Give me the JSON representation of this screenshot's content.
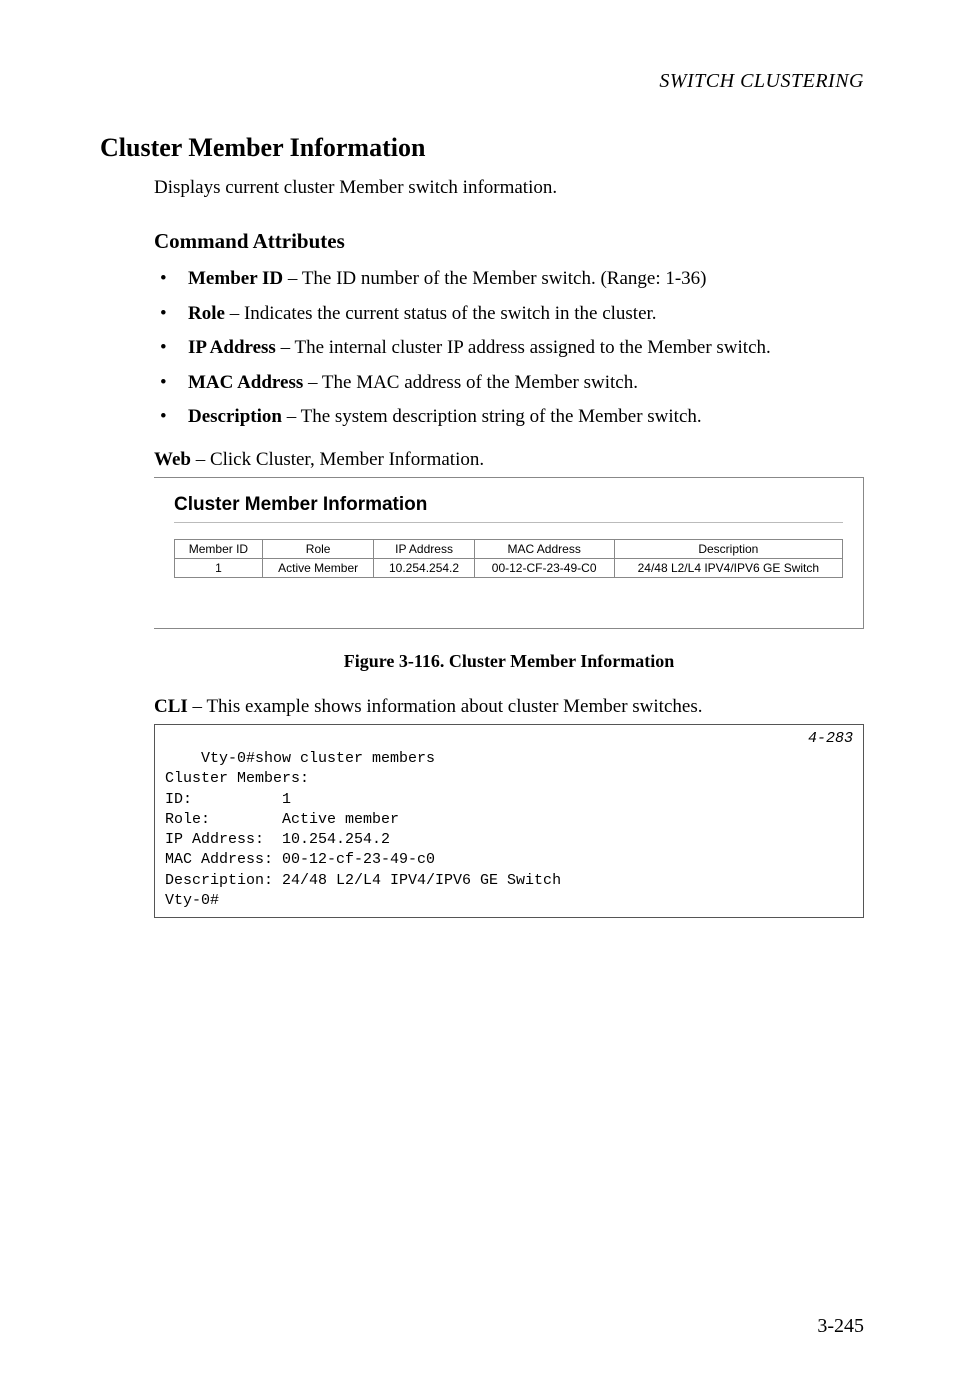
{
  "header": {
    "section": "SWITCH CLUSTERING"
  },
  "h2": "Cluster Member Information",
  "intro": "Displays current cluster Member switch information.",
  "h3": "Command Attributes",
  "bullets": [
    {
      "term": "Member ID",
      "desc": " – The ID number of the Member switch. (Range: 1-36)"
    },
    {
      "term": "Role",
      "desc": " – Indicates the current status of the switch in the cluster."
    },
    {
      "term": "IP Address",
      "desc": " – The internal cluster IP address assigned to the Member switch."
    },
    {
      "term": "MAC Address",
      "desc": " – The MAC address of the Member switch."
    },
    {
      "term": "Description",
      "desc": " – The system description string of the Member switch."
    }
  ],
  "web_label": "Web",
  "web_text": " – Click Cluster, Member Information.",
  "screenshot": {
    "title": "Cluster Member Information",
    "headers": [
      "Member ID",
      "Role",
      "IP Address",
      "MAC Address",
      "Description"
    ],
    "row": {
      "member_id": "1",
      "role": "Active Member",
      "ip": "10.254.254.2",
      "mac": "00-12-CF-23-49-C0",
      "desc": "24/48 L2/L4 IPV4/IPV6 GE Switch"
    }
  },
  "figure_caption": "Figure 3-116.  Cluster Member Information",
  "cli_label": "CLI",
  "cli_text": " – This example shows information about cluster Member switches.",
  "code": {
    "ref": "4-283",
    "lines": [
      "Vty-0#show cluster members",
      "Cluster Members:",
      "ID:          1",
      "Role:        Active member",
      "IP Address:  10.254.254.2",
      "MAC Address: 00-12-cf-23-49-c0",
      "Description: 24/48 L2/L4 IPV4/IPV6 GE Switch",
      "Vty-0#"
    ]
  },
  "page_number": "3-245"
}
